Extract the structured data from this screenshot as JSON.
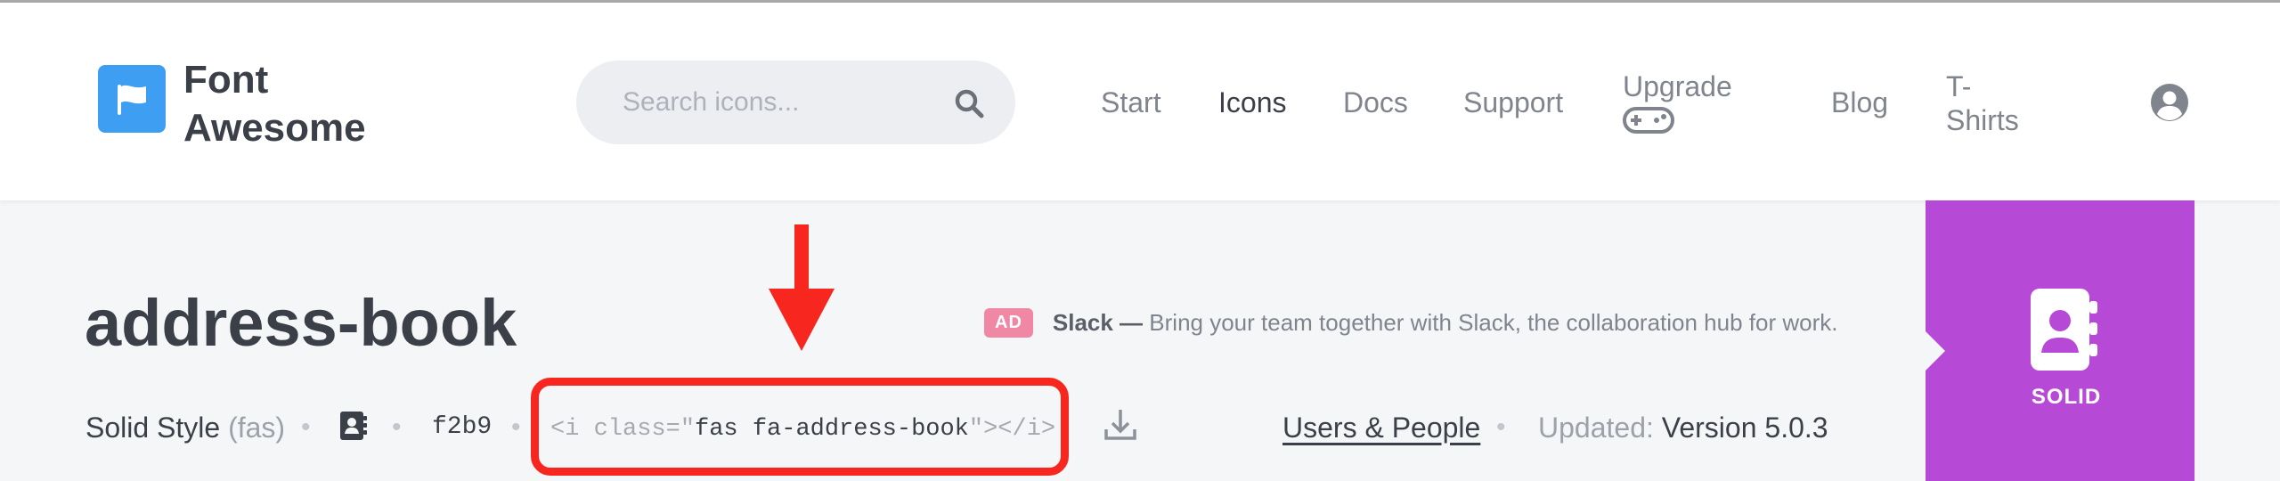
{
  "header": {
    "brand_line1": "Font",
    "brand_line2": "Awesome",
    "search_placeholder": "Search icons...",
    "nav": [
      "Start",
      "Icons",
      "Docs",
      "Support",
      "Upgrade",
      "Blog",
      "T-Shirts"
    ],
    "active_nav": "Icons"
  },
  "icon": {
    "name": "address-book",
    "style_name": "Solid Style",
    "style_prefix": "(fas)",
    "unicode": "f2b9",
    "code_open": "<i class=\"",
    "code_class": "fas fa-address-book",
    "code_close": "\"></i>",
    "category": "Users & People",
    "updated_label": "Updated:",
    "updated_value": "Version 5.0.3"
  },
  "ad": {
    "badge": "AD",
    "brand": "Slack —",
    "text": "Bring your team together with Slack, the collaboration hub for work."
  },
  "style_panel": {
    "label": "SOLID"
  },
  "colors": {
    "brand_blue": "#3e9ef2",
    "highlight_red": "#f7261f",
    "solid_purple": "#b649d6",
    "ad_pink": "#f087a5"
  },
  "separator": "•",
  "icons": [
    "flag-icon",
    "search-icon",
    "gamepad-icon",
    "user-circle-icon",
    "address-book-icon",
    "download-icon",
    "arrow-down-icon"
  ]
}
